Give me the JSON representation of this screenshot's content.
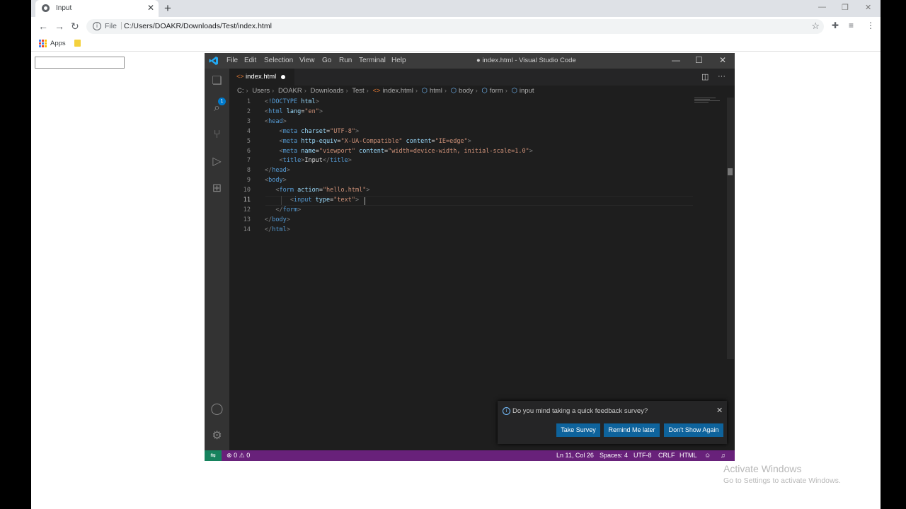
{
  "browser": {
    "tab_title": "Input",
    "url_scheme_label": "File",
    "url": "C:/Users/DOAKR/Downloads/Test/index.html",
    "bookmarks_apps_label": "Apps"
  },
  "vscode": {
    "menu": [
      "File",
      "Edit",
      "Selection",
      "View",
      "Go",
      "Run",
      "Terminal",
      "Help"
    ],
    "window_title": "● index.html - Visual Studio Code",
    "tab_name": "index.html",
    "breadcrumb": [
      "C:",
      "Users",
      "DOAKR",
      "Downloads",
      "Test",
      "index.html",
      "html",
      "body",
      "form",
      "input"
    ],
    "line_numbers": [
      "1",
      "2",
      "3",
      "4",
      "5",
      "6",
      "7",
      "8",
      "9",
      "10",
      "11",
      "12",
      "13",
      "14"
    ],
    "code": {
      "l1_doctype": "!DOCTYPE",
      "l1_html": "html",
      "l2_tag": "html",
      "l2_attr": "lang",
      "l2_val": "\"en\"",
      "l3_tag": "head",
      "l4_tag": "meta",
      "l4_attr": "charset",
      "l4_val": "\"UTF-8\"",
      "l5_tag": "meta",
      "l5_attr1": "http-equiv",
      "l5_val1": "\"X-UA-Compatible\"",
      "l5_attr2": "content",
      "l5_val2": "\"IE=edge\"",
      "l6_tag": "meta",
      "l6_attr1": "name",
      "l6_val1": "\"viewport\"",
      "l6_attr2": "content",
      "l6_val2": "\"width=device-width, initial-scale=1.0\"",
      "l7_tag": "title",
      "l7_text": "Input",
      "l7_close": "title",
      "l8_tag": "head",
      "l9_tag": "body",
      "l10_tag": "form",
      "l10_attr": "action",
      "l10_val": "\"hello.html\"",
      "l11_tag": "input",
      "l11_attr": "type",
      "l11_val": "\"text\"",
      "l12_tag": "form",
      "l13_tag": "body",
      "l14_tag": "html"
    },
    "notification": {
      "message": "Do you mind taking a quick feedback survey?",
      "buttons": [
        "Take Survey",
        "Remind Me later",
        "Don't Show Again"
      ]
    },
    "status": {
      "errors": "0",
      "warnings": "0",
      "position": "Ln 11, Col 26",
      "spaces": "Spaces: 4",
      "encoding": "UTF-8",
      "eol": "CRLF",
      "language": "HTML"
    },
    "files_badge": "1"
  },
  "watermark": {
    "title": "Activate Windows",
    "subtitle": "Go to Settings to activate Windows."
  }
}
